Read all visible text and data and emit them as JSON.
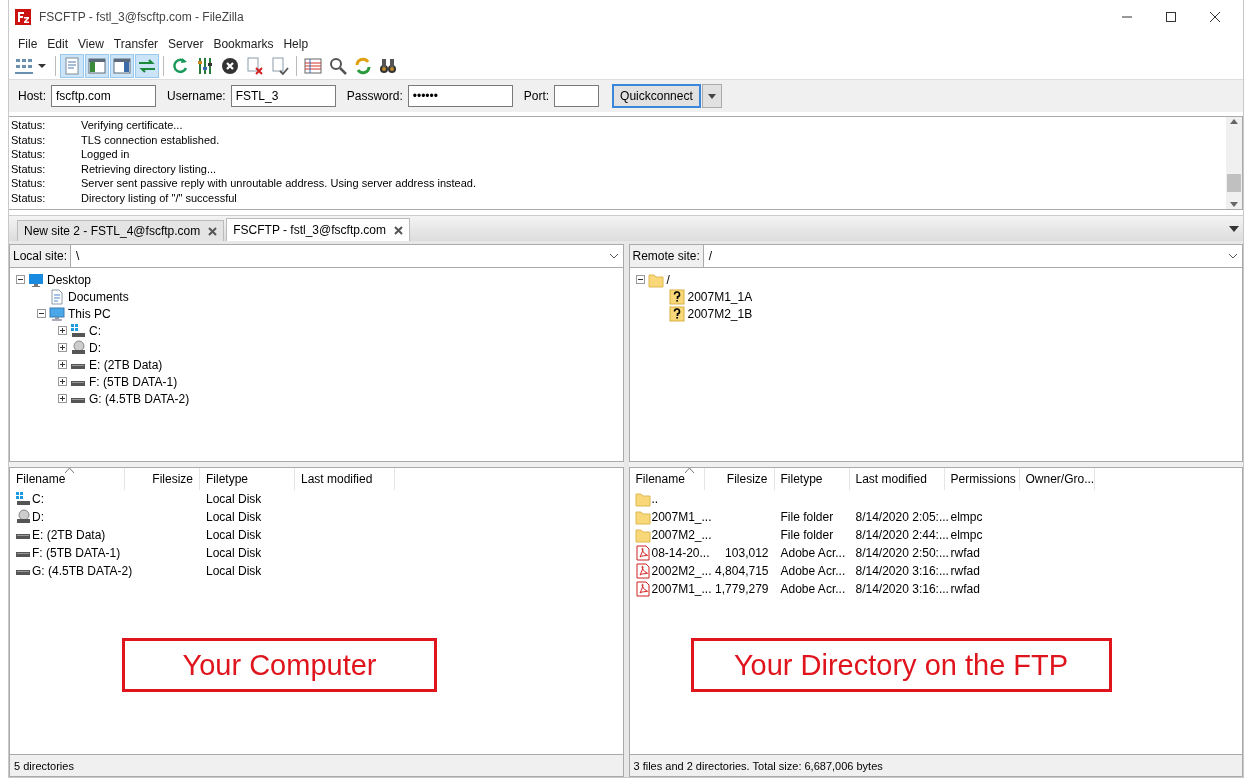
{
  "window": {
    "title": "FSCFTP - fstl_3@fscftp.com - FileZilla"
  },
  "menu": [
    "File",
    "Edit",
    "View",
    "Transfer",
    "Server",
    "Bookmarks",
    "Help"
  ],
  "toolbar": {
    "buttons": [
      {
        "kind": "site-manager",
        "pressed": false
      },
      {
        "kind": "dropdown",
        "pressed": false
      },
      {
        "kind": "toggle-log",
        "pressed": true
      },
      {
        "kind": "toggle-local-tree",
        "pressed": true
      },
      {
        "kind": "toggle-remote-tree",
        "pressed": true
      },
      {
        "kind": "toggle-queue",
        "pressed": true
      },
      {
        "kind": "refresh",
        "pressed": false
      },
      {
        "kind": "filter",
        "pressed": false
      },
      {
        "kind": "cancel",
        "pressed": false
      },
      {
        "kind": "disconnect",
        "pressed": false
      },
      {
        "kind": "reconnect",
        "pressed": false
      },
      {
        "kind": "compare",
        "pressed": false
      },
      {
        "kind": "find",
        "pressed": false
      },
      {
        "kind": "sync",
        "pressed": false
      },
      {
        "kind": "search",
        "pressed": false
      }
    ]
  },
  "quickconnect": {
    "host": {
      "label": "Host:",
      "value": "fscftp.com"
    },
    "username": {
      "label": "Username:",
      "value": "FSTL_3"
    },
    "password": {
      "label": "Password:",
      "value": "••••••"
    },
    "port": {
      "label": "Port:"
    },
    "button": "Quickconnect"
  },
  "log": [
    {
      "label": "Status:",
      "message": "Verifying certificate..."
    },
    {
      "label": "Status:",
      "message": "TLS connection established."
    },
    {
      "label": "Status:",
      "message": "Logged in"
    },
    {
      "label": "Status:",
      "message": "Retrieving directory listing..."
    },
    {
      "label": "Status:",
      "message": "Server sent passive reply with unroutable address. Using server address instead."
    },
    {
      "label": "Status:",
      "message": "Directory listing of \"/\" successful"
    }
  ],
  "tabs": [
    {
      "label": "New site 2 - FSTL_4@fscftp.com",
      "selected": false
    },
    {
      "label": "FSCFTP - fstl_3@fscftp.com",
      "selected": true
    }
  ],
  "local": {
    "site_label": "Local site:",
    "path": "\\",
    "tree": [
      {
        "label": "Desktop",
        "kind": "desktop",
        "expanded": true,
        "children": [
          {
            "label": "Documents",
            "kind": "document"
          },
          {
            "label": "This PC",
            "kind": "pc",
            "expanded": true,
            "children": [
              {
                "label": "C:",
                "kind": "drive-windows",
                "expanded": false
              },
              {
                "label": "D:",
                "kind": "drive-optical",
                "expanded": false
              },
              {
                "label": "E: (2TB Data)",
                "kind": "drive",
                "expanded": false
              },
              {
                "label": "F: (5TB DATA-1)",
                "kind": "drive",
                "expanded": false
              },
              {
                "label": "G: (4.5TB DATA-2)",
                "kind": "drive",
                "expanded": false
              }
            ]
          }
        ]
      }
    ],
    "columns": [
      "Filename",
      "Filesize",
      "Filetype",
      "Last modified"
    ],
    "rows": [
      {
        "kind": "drive-windows",
        "cells": [
          "C:",
          "",
          "Local Disk",
          ""
        ]
      },
      {
        "kind": "drive-optical",
        "cells": [
          "D:",
          "",
          "Local Disk",
          ""
        ]
      },
      {
        "kind": "drive",
        "cells": [
          "E: (2TB Data)",
          "",
          "Local Disk",
          ""
        ]
      },
      {
        "kind": "drive",
        "cells": [
          "F: (5TB DATA-1)",
          "",
          "Local Disk",
          ""
        ]
      },
      {
        "kind": "drive",
        "cells": [
          "G: (4.5TB DATA-2)",
          "",
          "Local Disk",
          ""
        ]
      }
    ],
    "annotation": "Your Computer",
    "status": "5 directories"
  },
  "remote": {
    "site_label": "Remote site:",
    "path": "/",
    "tree": [
      {
        "label": "/",
        "kind": "folder",
        "expanded": true,
        "children": [
          {
            "label": "2007M1_1A",
            "kind": "unknown"
          },
          {
            "label": "2007M2_1B",
            "kind": "unknown"
          }
        ]
      }
    ],
    "columns": [
      "Filename",
      "Filesize",
      "Filetype",
      "Last modified",
      "Permissions",
      "Owner/Gro..."
    ],
    "rows": [
      {
        "kind": "folder",
        "cells": [
          "..",
          "",
          "",
          "",
          "",
          ""
        ]
      },
      {
        "kind": "folder",
        "cells": [
          "2007M1_...",
          "",
          "File folder",
          "8/14/2020 2:05:...",
          "elmpc",
          ""
        ]
      },
      {
        "kind": "folder",
        "cells": [
          "2007M2_...",
          "",
          "File folder",
          "8/14/2020 2:44:...",
          "elmpc",
          ""
        ]
      },
      {
        "kind": "pdf",
        "cells": [
          "08-14-20...",
          "103,012",
          "Adobe Acr...",
          "8/14/2020 2:50:...",
          "rwfad",
          ""
        ]
      },
      {
        "kind": "pdf",
        "cells": [
          "2002M2_...",
          "4,804,715",
          "Adobe Acr...",
          "8/14/2020 3:16:...",
          "rwfad",
          ""
        ]
      },
      {
        "kind": "pdf",
        "cells": [
          "2007M1_...",
          "1,779,279",
          "Adobe Acr...",
          "8/14/2020 3:16:...",
          "rwfad",
          ""
        ]
      }
    ],
    "annotation": "Your Directory on the FTP",
    "status": "3 files and 2 directories. Total size: 6,687,006 bytes"
  }
}
